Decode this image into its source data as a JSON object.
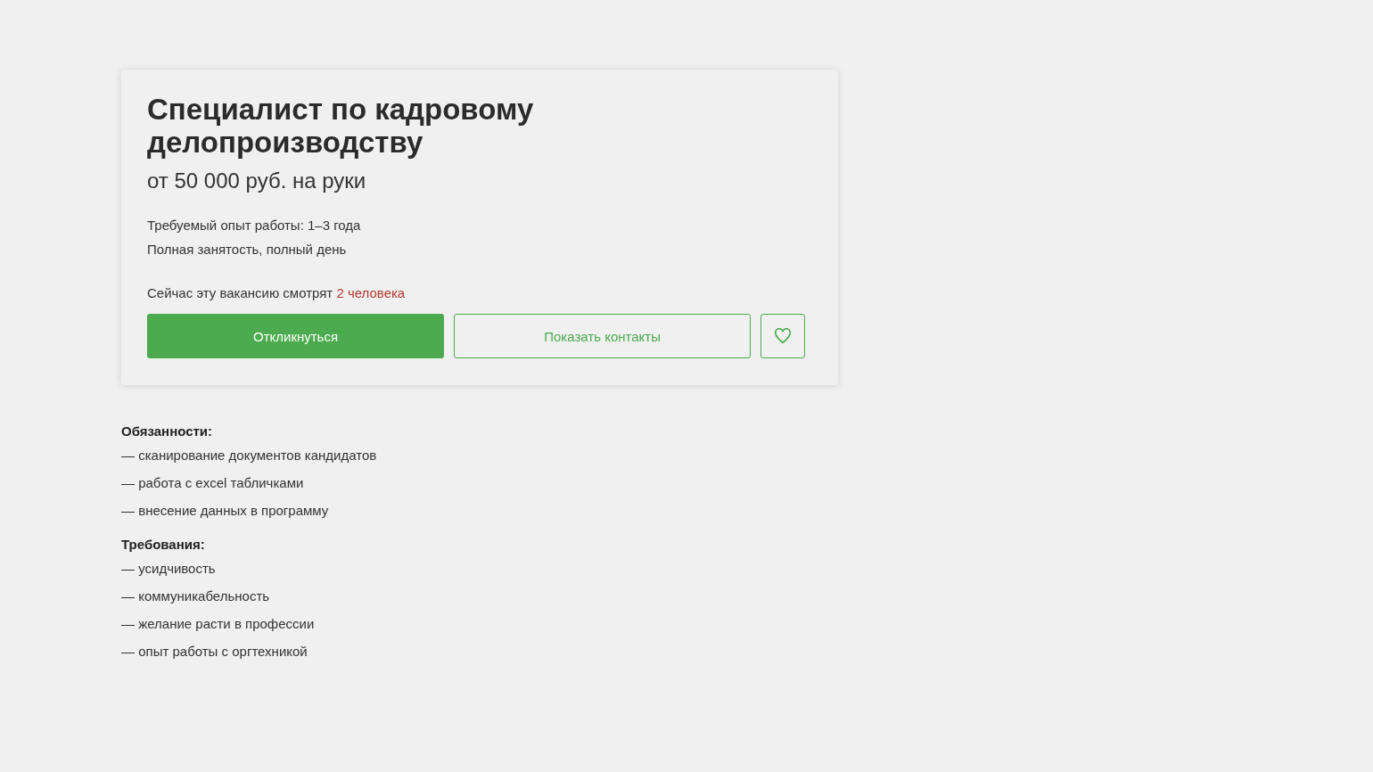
{
  "vacancy": {
    "title": "Специалист по кадровому делопроизводству",
    "salary": "от 50 000 руб. на руки",
    "experience": "Требуемый опыт работы: 1–3 года",
    "employment": "Полная занятость, полный день",
    "viewers_text": "Сейчас эту вакансию смотрят",
    "viewers_count": "2 человека",
    "apply_button": "Откликнуться",
    "contacts_button": "Показать контакты",
    "favorite": false
  },
  "sections": [
    {
      "heading": "Обязанности:",
      "items": [
        "— сканирование документов кандидатов",
        "— работа с excel табличками",
        "— внесение данных в программу"
      ]
    },
    {
      "heading": "Требования:",
      "items": [
        "— усидчивость",
        "— коммуникабельность",
        "— желание расти в профессии",
        "— опыт работы с оргтехникой"
      ]
    }
  ]
}
